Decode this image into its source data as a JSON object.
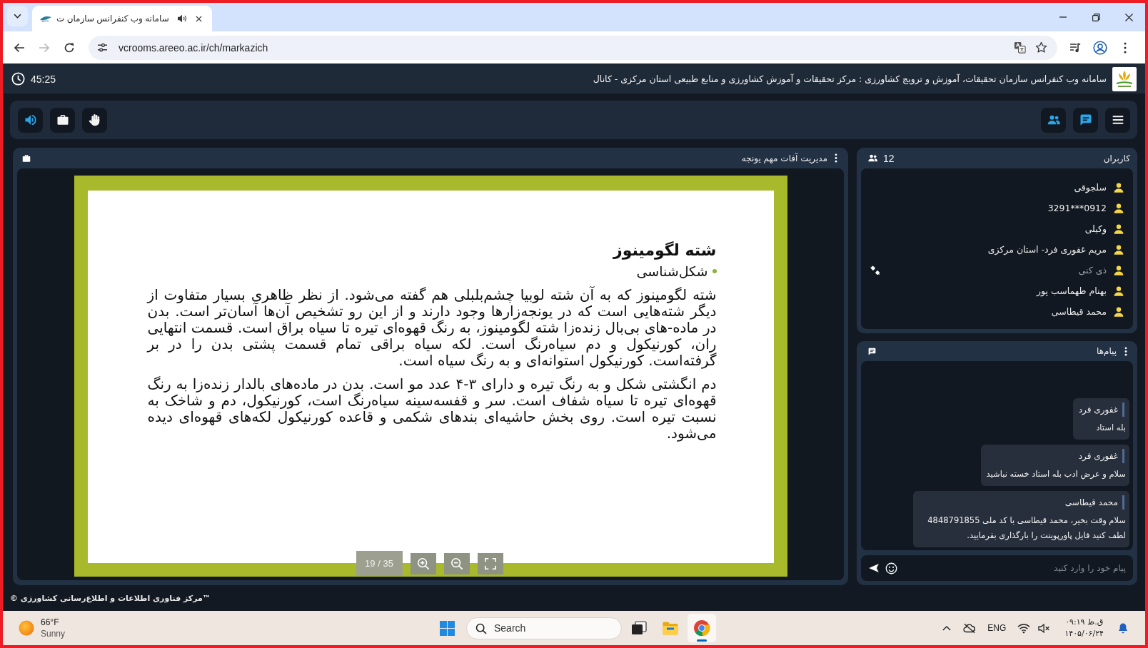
{
  "browser": {
    "tab": {
      "title": "سامانه وب کنفرانس سازمان ت",
      "audio_playing": true
    },
    "back_disabled": false,
    "forward_disabled": true,
    "url": "vcrooms.areeo.ac.ir/ch/markazich"
  },
  "header": {
    "title": "سامانه وب کنفرانس سازمان تحقیقات، آموزش و ترویج کشاورزی : مرکز تحقیقات و آموزش کشاورزی و منابع طبیعی استان مرکزی - کانال",
    "timer": "45:25"
  },
  "toolbar": {
    "left": [
      {
        "kind": "audio",
        "active": true
      },
      {
        "kind": "share",
        "active": false
      },
      {
        "kind": "hand",
        "active": false
      }
    ],
    "right": [
      {
        "kind": "users",
        "active": true
      },
      {
        "kind": "chat",
        "active": true
      },
      {
        "kind": "menu",
        "active": false
      }
    ]
  },
  "presentation": {
    "title": "مدیریت آفات مهم یونجه",
    "slide": {
      "heading": "شته لگومینوز",
      "bullet": "شکل‌شناسی",
      "paragraphs": [
        "شته لگومینوز که به آن شته لوبیا چشم‌بلبلی هم گفته می‌شود. از نظر ظاهری بسیار متفاوت از دیگر شته‌هایی است که در یونجه‌زارها وجود دارند و از این رو تشخیص آن‌ها آسان‌تر است.  بدن در ماده-های بی‌بال زنده‌زا شته لگومینوز، به رنگ قهوه‌ای تیره تا سیاه براق است. قسمت انتهایی ران، کورنیکول و دم سیاه‌رنگ است. لکه سیاه براقی تمام قسمت پشتی بدن را در بر گرفته‌است. کورنیکول استوانه‌ای و به رنگ سیاه است.",
        "دم انگشتی شکل و به رنگ تیره و دارای ۳-۴ عدد مو است. بدن در ماده‌های بالدار زنده‌زا به رنگ قهوه‌ای تیره تا سیاه شفاف است. سر و قفسه‌سینه سیاه‌رنگ است، کورنیکول، دم و شاخک به نسبت تیره است. روی بخش حاشیه‌ای بندهای شکمی و قاعده کورنیکول لکه‌های قهوه‌ای دیده می‌شود."
      ]
    },
    "counter": "19 / 35"
  },
  "users": {
    "title": "کاربران",
    "count": "12",
    "items": [
      {
        "name": "سلجوقی",
        "connected": true
      },
      {
        "name": "0912***3291",
        "connected": true
      },
      {
        "name": "وکیلی",
        "connected": true
      },
      {
        "name": "مریم غفوری فرد- استان مرکزی",
        "connected": true
      },
      {
        "name": "ذی کنی",
        "connected": false
      },
      {
        "name": "بهنام طهماسب پور",
        "connected": true
      },
      {
        "name": "محمد قیطاسی",
        "connected": true
      }
    ]
  },
  "messages": {
    "title": "پیام‌ها",
    "items": [
      {
        "sender": "غفوری فرد",
        "text": "بله استاد"
      },
      {
        "sender": "غفوری فرد",
        "text": "سلام و عرض ادب بله استاد خسته نباشید"
      },
      {
        "sender": "محمد قیطاسی",
        "text": "سلام وقت بخیر، محمد قیطاسی با کد ملی 4848791855 لطف کنید فایل پاورپوینت را بارگذاری بفرمایید."
      }
    ],
    "input": {
      "placeholder": "پیام خود را وارد کنید"
    }
  },
  "footer": "© مرکز فناوری اطلاعات و اطلاع‌رسانی کشاورزی™",
  "taskbar": {
    "weather": {
      "temperature": "66°F",
      "condition": "Sunny"
    },
    "search": {
      "placeholder": "Search"
    },
    "apps": [
      {
        "kind": "task-view",
        "running": false
      },
      {
        "kind": "files",
        "running": false
      },
      {
        "kind": "browser",
        "running": true
      }
    ],
    "language": "ENG",
    "time": "۰۹:۱۹ ق.ظ",
    "date": "۱۴۰۵/۰۶/۲۴"
  }
}
